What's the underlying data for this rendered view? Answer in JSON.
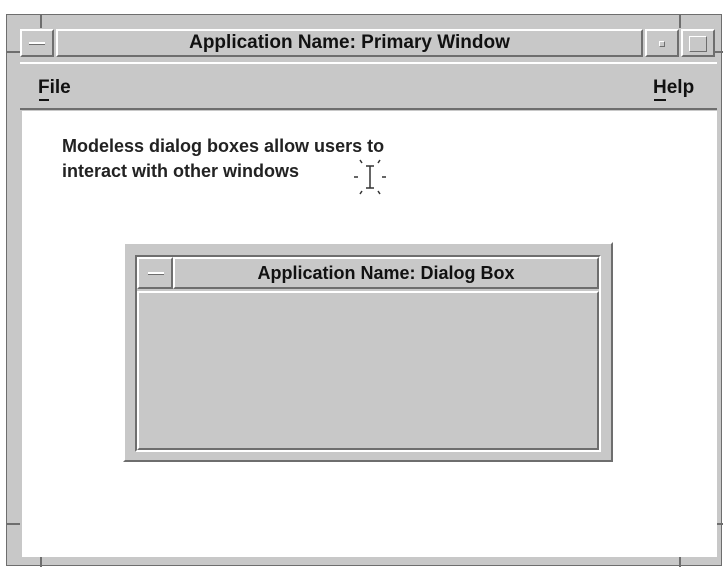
{
  "primary_window": {
    "title": "Application Name: Primary Window",
    "menus": {
      "file": "File",
      "help": "Help"
    },
    "message_line1": "Modeless dialog boxes allow users to",
    "message_line2": "interact with other windows"
  },
  "dialog": {
    "title": "Application Name: Dialog Box"
  },
  "icons": {
    "window_menu": "window-menu-icon",
    "minimize": "minimize-icon",
    "maximize": "maximize-icon",
    "text_cursor": "ibeam-cursor-icon"
  },
  "colors": {
    "frame": "#c8c8c8",
    "shadow": "#6e6e6e",
    "highlight": "#ffffff",
    "text": "#111111"
  }
}
